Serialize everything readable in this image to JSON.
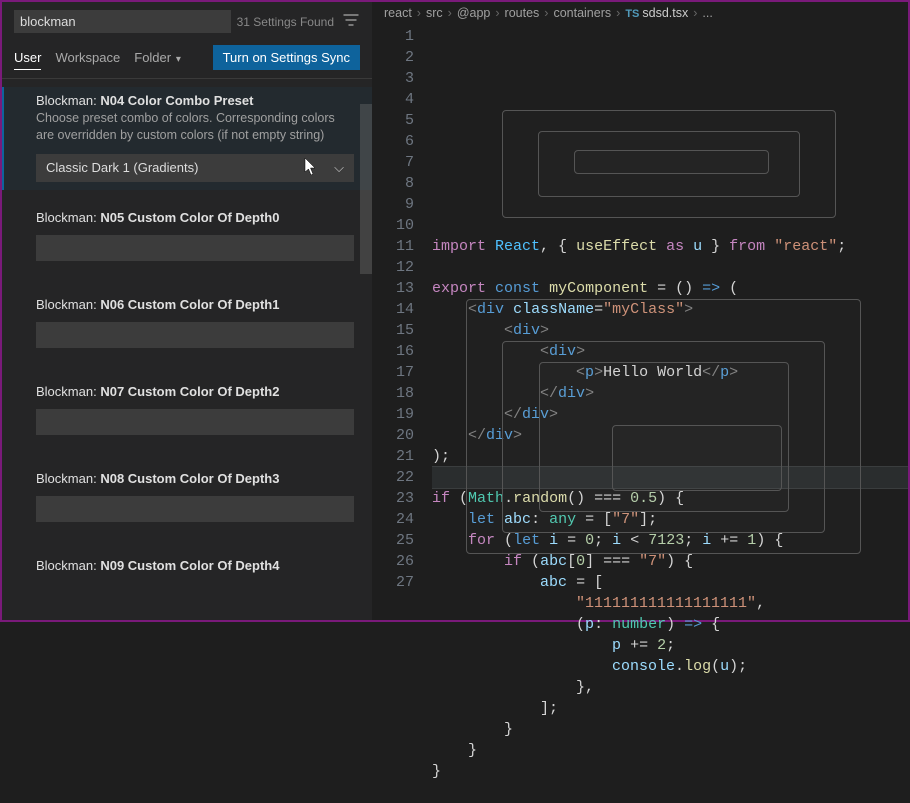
{
  "settings": {
    "search_value": "blockman",
    "found_label": "31 Settings Found",
    "scopes": {
      "user": "User",
      "workspace": "Workspace",
      "folder": "Folder"
    },
    "sync_button": "Turn on Settings Sync",
    "items": [
      {
        "ext": "Blockman:",
        "name": "N04 Color Combo Preset",
        "desc": "Choose preset combo of colors. Corresponding colors are overridden by custom colors (if not empty string)",
        "select_value": "Classic Dark 1 (Gradients)",
        "type": "select"
      },
      {
        "ext": "Blockman:",
        "name": "N05 Custom Color Of Depth0",
        "type": "input"
      },
      {
        "ext": "Blockman:",
        "name": "N06 Custom Color Of Depth1",
        "type": "input"
      },
      {
        "ext": "Blockman:",
        "name": "N07 Custom Color Of Depth2",
        "type": "input"
      },
      {
        "ext": "Blockman:",
        "name": "N08 Custom Color Of Depth3",
        "type": "input"
      },
      {
        "ext": "Blockman:",
        "name": "N09 Custom Color Of Depth4",
        "type": "input"
      }
    ]
  },
  "breadcrumbs": [
    "react",
    "src",
    "@app",
    "routes",
    "containers",
    "sdsd.tsx",
    "..."
  ],
  "code_lines": [
    "<span class='kw'>import</span> <span class='con'>React</span><span class='pn'>, { </span><span class='fn'>useEffect</span> <span class='kw'>as</span> <span class='id'>u</span><span class='pn'> } </span><span class='kw'>from</span> <span class='str'>\"react\"</span><span class='pn'>;</span>",
    "",
    "<span class='kw'>export</span> <span class='kw2'>const</span> <span class='fn'>myComponent</span> <span class='pn'>= () </span><span class='kw2'>=&gt;</span> <span class='pn'>(</span>",
    "    <span class='ang'>&lt;</span><span class='tag'>div</span> <span class='attr'>className</span><span class='pn'>=</span><span class='str'>\"myClass\"</span><span class='ang'>&gt;</span>",
    "        <span class='ang'>&lt;</span><span class='tag'>div</span><span class='ang'>&gt;</span>",
    "            <span class='ang'>&lt;</span><span class='tag'>div</span><span class='ang'>&gt;</span>",
    "                <span class='ang'>&lt;</span><span class='tag'>p</span><span class='ang'>&gt;</span>Hello World<span class='ang'>&lt;/</span><span class='tag'>p</span><span class='ang'>&gt;</span>",
    "            <span class='ang'>&lt;/</span><span class='tag'>div</span><span class='ang'>&gt;</span>",
    "        <span class='ang'>&lt;/</span><span class='tag'>div</span><span class='ang'>&gt;</span>",
    "    <span class='ang'>&lt;/</span><span class='tag'>div</span><span class='ang'>&gt;</span>",
    "<span class='pn'>);</span>",
    "",
    "<span class='kw'>if</span> <span class='pn'>(</span><span class='ty'>Math</span><span class='pn'>.</span><span class='fn'>random</span><span class='pn'>() === </span><span class='num'>0.5</span><span class='pn'>) {</span>",
    "    <span class='kw2'>let</span> <span class='id'>abc</span><span class='pn'>: </span><span class='ty'>any</span> <span class='pn'>= [</span><span class='str'>\"7\"</span><span class='pn'>];</span>",
    "    <span class='kw'>for</span> <span class='pn'>(</span><span class='kw2'>let</span> <span class='id'>i</span> <span class='pn'>= </span><span class='num'>0</span><span class='pn'>; </span><span class='id'>i</span> <span class='pn'>&lt; </span><span class='num'>7123</span><span class='pn'>; </span><span class='id'>i</span> <span class='pn'>+= </span><span class='num'>1</span><span class='pn'>) {</span>",
    "        <span class='kw'>if</span> <span class='pn'>(</span><span class='id'>abc</span><span class='pn'>[</span><span class='num'>0</span><span class='pn'>] === </span><span class='str'>\"7\"</span><span class='pn'>) {</span>",
    "            <span class='id'>abc</span> <span class='pn'>= [</span>",
    "                <span class='str'>\"111111111111111111\"</span><span class='pn'>,</span>",
    "                <span class='pn'>(</span><span class='id'>p</span><span class='pn'>: </span><span class='ty'>number</span><span class='pn'>) </span><span class='kw2'>=&gt;</span> <span class='pn'>{</span>",
    "                    <span class='id'>p</span> <span class='pn'>+= </span><span class='num'>2</span><span class='pn'>;</span>",
    "                    <span class='id'>console</span><span class='pn'>.</span><span class='fn'>log</span><span class='pn'>(</span><span class='id'>u</span><span class='pn'>);</span>",
    "                <span class='pn'>},</span>",
    "            <span class='pn'>];</span>",
    "        <span class='pn'>}</span>",
    "    <span class='pn'>}</span>",
    "<span class='pn'>}</span>",
    ""
  ]
}
